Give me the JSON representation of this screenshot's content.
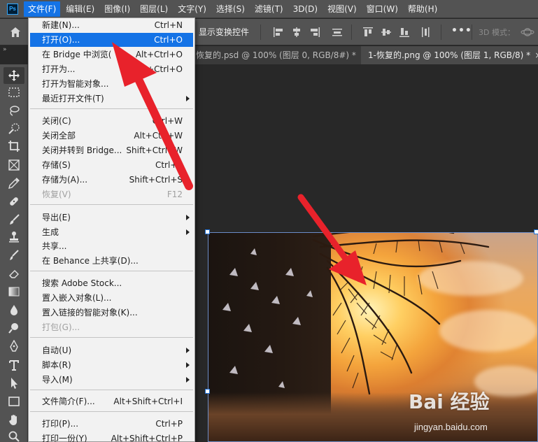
{
  "menubar": {
    "logo": "Ps",
    "items": [
      "文件(F)",
      "编辑(E)",
      "图像(I)",
      "图层(L)",
      "文字(Y)",
      "选择(S)",
      "滤镜(T)",
      "3D(D)",
      "视图(V)",
      "窗口(W)",
      "帮助(H)"
    ],
    "active_index": 0
  },
  "options_bar": {
    "show_transform_label": "显示变换控件",
    "more_label": "•••",
    "mode_3d_label": "3D 模式："
  },
  "tabs": [
    {
      "label": "恢复的.psd @ 100% (图层 0, RGB/8#) *",
      "close": "×"
    },
    {
      "label": "1-恢复的.png @ 100% (图层 1, RGB/8) *",
      "close": "×"
    }
  ],
  "collapse_label": "»",
  "file_menu": {
    "items": [
      {
        "label": "新建(N)...",
        "shortcut": "Ctrl+N",
        "state": "normal",
        "submenu": false
      },
      {
        "label": "打开(O)...",
        "shortcut": "Ctrl+O",
        "state": "highlighted",
        "submenu": false
      },
      {
        "label": "在 Bridge 中浏览(",
        "shortcut": "Alt+Ctrl+O",
        "state": "normal",
        "submenu": false
      },
      {
        "label": "打开为...",
        "shortcut": "hift+Ctrl+O",
        "state": "normal",
        "submenu": false
      },
      {
        "label": "打开为智能对象...",
        "shortcut": "",
        "state": "normal",
        "submenu": false
      },
      {
        "label": "最近打开文件(T)",
        "shortcut": "",
        "state": "normal",
        "submenu": true
      },
      {
        "label": "关闭(C)",
        "shortcut": "Ctrl+W",
        "state": "normal",
        "submenu": false
      },
      {
        "label": "关闭全部",
        "shortcut": "Alt+Ctrl+W",
        "state": "normal",
        "submenu": false
      },
      {
        "label": "关闭并转到 Bridge...",
        "shortcut": "Shift+Ctrl+W",
        "state": "normal",
        "submenu": false
      },
      {
        "label": "存储(S)",
        "shortcut": "Ctrl+S",
        "state": "normal",
        "submenu": false
      },
      {
        "label": "存储为(A)...",
        "shortcut": "Shift+Ctrl+S",
        "state": "normal",
        "submenu": false
      },
      {
        "label": "恢复(V)",
        "shortcut": "F12",
        "state": "disabled",
        "submenu": false
      },
      {
        "label": "导出(E)",
        "shortcut": "",
        "state": "normal",
        "submenu": true
      },
      {
        "label": "生成",
        "shortcut": "",
        "state": "normal",
        "submenu": true
      },
      {
        "label": "共享...",
        "shortcut": "",
        "state": "normal",
        "submenu": false
      },
      {
        "label": "在 Behance 上共享(D)...",
        "shortcut": "",
        "state": "normal",
        "submenu": false
      },
      {
        "label": "搜索 Adobe Stock...",
        "shortcut": "",
        "state": "normal",
        "submenu": false
      },
      {
        "label": "置入嵌入对象(L)...",
        "shortcut": "",
        "state": "normal",
        "submenu": false
      },
      {
        "label": "置入链接的智能对象(K)...",
        "shortcut": "",
        "state": "normal",
        "submenu": false
      },
      {
        "label": "打包(G)...",
        "shortcut": "",
        "state": "disabled",
        "submenu": false
      },
      {
        "label": "自动(U)",
        "shortcut": "",
        "state": "normal",
        "submenu": true
      },
      {
        "label": "脚本(R)",
        "shortcut": "",
        "state": "normal",
        "submenu": true
      },
      {
        "label": "导入(M)",
        "shortcut": "",
        "state": "normal",
        "submenu": true
      },
      {
        "label": "文件简介(F)...",
        "shortcut": "Alt+Shift+Ctrl+I",
        "state": "normal",
        "submenu": false
      },
      {
        "label": "打印(P)...",
        "shortcut": "Ctrl+P",
        "state": "normal",
        "submenu": false
      },
      {
        "label": "打印一份(Y)",
        "shortcut": "Alt+Shift+Ctrl+P",
        "state": "normal",
        "submenu": false
      }
    ]
  },
  "tools": [
    "move-tool",
    "marquee-tool",
    "lasso-tool",
    "quick-select-tool",
    "crop-tool",
    "frame-tool",
    "eyedropper-tool",
    "healing-brush-tool",
    "brush-tool",
    "clone-stamp-tool",
    "history-brush-tool",
    "eraser-tool",
    "gradient-tool",
    "blur-tool",
    "dodge-tool",
    "pen-tool",
    "type-tool",
    "path-select-tool",
    "rectangle-tool",
    "hand-tool",
    "zoom-tool"
  ],
  "watermark": {
    "logo": "Bai 经验",
    "url": "jingyan.baidu.com"
  },
  "colors": {
    "accent": "#1473e6",
    "annotation": "#e8222b",
    "panel": "#535353",
    "canvas": "#282828"
  }
}
